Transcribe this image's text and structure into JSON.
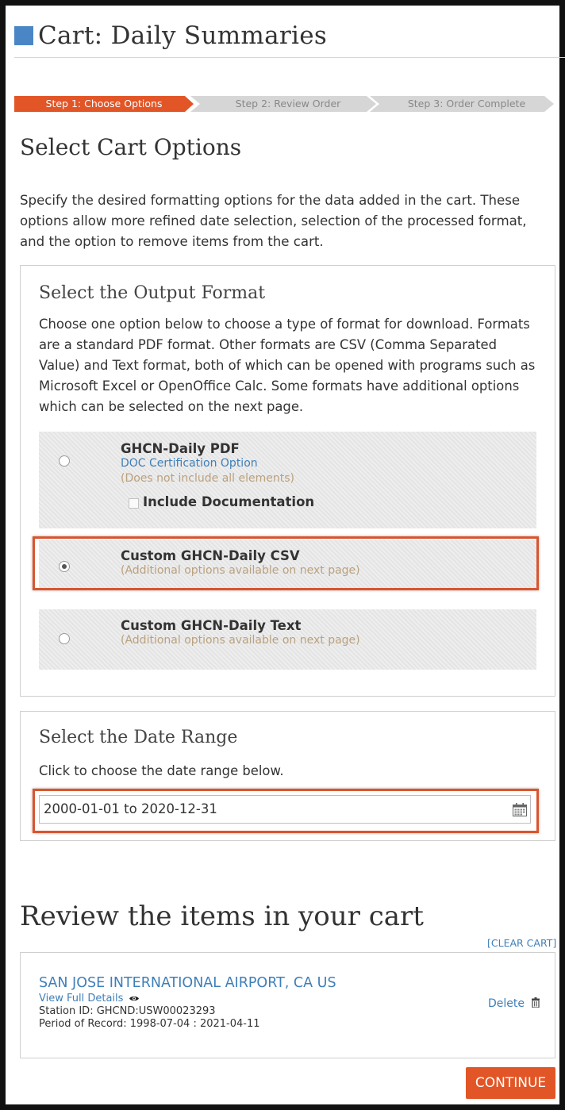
{
  "page": {
    "title": "Cart: Daily Summaries"
  },
  "steps": [
    "Step 1: Choose Options",
    "Step 2: Review Order",
    "Step 3: Order Complete"
  ],
  "options_section": {
    "heading": "Select Cart Options",
    "intro": "Specify the desired formatting options for the data added in the cart. These options allow more refined date selection, selection of the processed format, and the option to remove items from the cart."
  },
  "output_format": {
    "heading": "Select the Output Format",
    "description": "Choose one option below to choose a type of format for download. Formats are a standard PDF format. Other formats are CSV (Comma Separated Value) and Text format, both of which can be opened with programs such as Microsoft Excel or OpenOffice Calc. Some formats have additional options which can be selected on the next page.",
    "options": [
      {
        "title": "GHCN-Daily PDF",
        "link": "DOC Certification Option",
        "note": "(Does not include all elements)",
        "checkbox_label": "Include Documentation",
        "selected": false
      },
      {
        "title": "Custom GHCN-Daily CSV",
        "note": "(Additional options available on next page)",
        "selected": true
      },
      {
        "title": "Custom GHCN-Daily Text",
        "note": "(Additional options available on next page)",
        "selected": false
      }
    ]
  },
  "date_range": {
    "heading": "Select the Date Range",
    "instruction": "Click to choose the date range below.",
    "value": "2000-01-01 to 2020-12-31"
  },
  "cart": {
    "heading": "Review the items in your cart",
    "clear_label": "[CLEAR CART]",
    "items": [
      {
        "station": "SAN JOSE INTERNATIONAL AIRPORT, CA US",
        "view_details": "View Full Details",
        "station_id": "Station ID: GHCND:USW00023293",
        "period": "Period of Record: 1998-07-04 : 2021-04-11",
        "delete_label": "Delete"
      }
    ]
  },
  "continue_label": "CONTINUE",
  "colors": {
    "accent": "#e25526",
    "link": "#3f7fb8",
    "title_square": "#4a86c5",
    "note": "#bba17e"
  }
}
